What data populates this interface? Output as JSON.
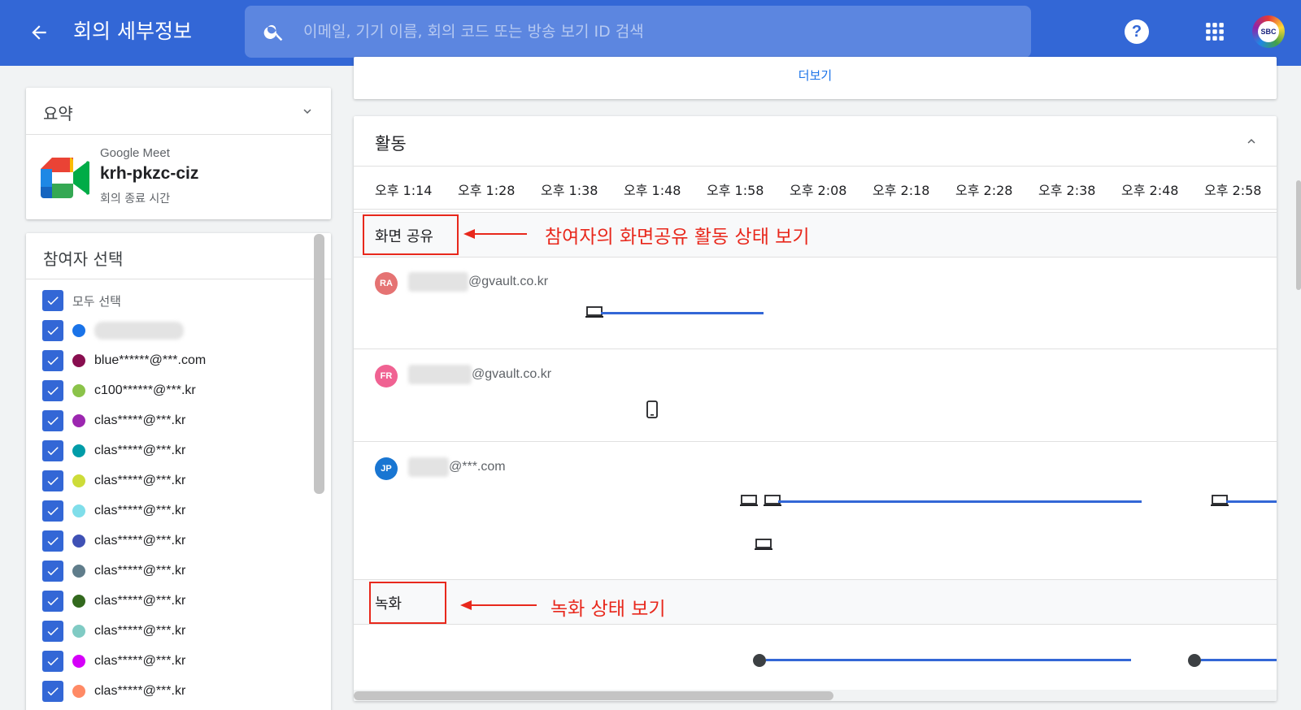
{
  "header": {
    "title": "회의 세부정보",
    "search_placeholder": "이메일, 기기 이름, 회의 코드 또는 방송 보기 ID 검색",
    "help_label": "?",
    "avatar_text": "SBC"
  },
  "summary": {
    "title": "요약",
    "app_name": "Google Meet",
    "meeting_code": "krh-pkzc-ciz",
    "end_label": "회의 종료 시간"
  },
  "participants": {
    "title": "참여자 선택",
    "select_all": "모두 선택",
    "items": [
      {
        "email": "",
        "color": "#1a73e8"
      },
      {
        "email": "blue******@***.com",
        "color": "#880e4f"
      },
      {
        "email": "c100******@***.kr",
        "color": "#8bc34a"
      },
      {
        "email": "clas*****@***.kr",
        "color": "#9c27b0"
      },
      {
        "email": "clas*****@***.kr",
        "color": "#009ca8"
      },
      {
        "email": "clas*****@***.kr",
        "color": "#cddc39"
      },
      {
        "email": "clas*****@***.kr",
        "color": "#80deea"
      },
      {
        "email": "clas*****@***.kr",
        "color": "#3f51b5"
      },
      {
        "email": "clas*****@***.kr",
        "color": "#607d8b"
      },
      {
        "email": "clas*****@***.kr",
        "color": "#33691e"
      },
      {
        "email": "clas*****@***.kr",
        "color": "#80cbc4"
      },
      {
        "email": "clas*****@***.kr",
        "color": "#d500f9"
      },
      {
        "email": "clas*****@***.kr",
        "color": "#ff8a65"
      }
    ]
  },
  "more_card": {
    "link": "더보기"
  },
  "activity": {
    "title": "활동",
    "times": [
      "오후 1:14",
      "오후 1:28",
      "오후 1:38",
      "오후 1:48",
      "오후 1:58",
      "오후 2:08",
      "오후 2:18",
      "오후 2:28",
      "오후 2:38",
      "오후 2:48",
      "오후 2:58"
    ],
    "screen_share_label": "화면 공유",
    "recording_label": "녹화",
    "rows": [
      {
        "initials": "RA",
        "email_suffix": "@gvault.co.kr",
        "avatar_color": "#e57373"
      },
      {
        "initials": "FR",
        "email_suffix": "@gvault.co.kr",
        "avatar_color": "#f06292"
      },
      {
        "initials": "JP",
        "email_suffix": "@***.com",
        "avatar_color": "#1976d2"
      }
    ]
  },
  "annotations": {
    "screen_share": "참여자의 화면공유 활동 상태 보기",
    "recording": "녹화 상태 보기",
    "color": "#e8281c"
  }
}
